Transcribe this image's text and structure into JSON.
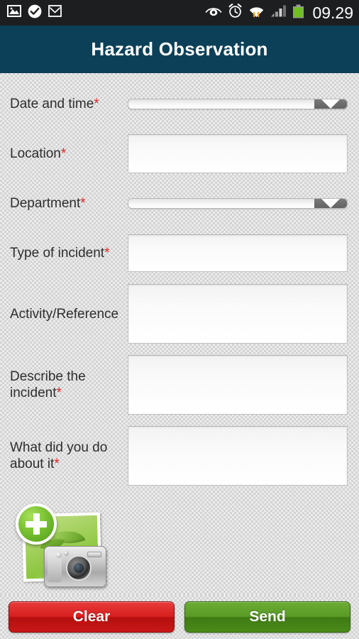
{
  "statusbar": {
    "time": "09.29",
    "left_icons": [
      {
        "name": "image-icon"
      },
      {
        "name": "check-circle-icon"
      },
      {
        "name": "gmail-icon"
      }
    ],
    "right_icons": [
      {
        "name": "eye-icon"
      },
      {
        "name": "alarm-clock-icon"
      },
      {
        "name": "wifi-data-transfer-icon"
      },
      {
        "name": "cellular-signal-icon"
      },
      {
        "name": "battery-icon"
      }
    ]
  },
  "header": {
    "title": "Hazard Observation",
    "background_color": "#0c4058"
  },
  "form": {
    "required_marker": "*",
    "fields": [
      {
        "label": "Date and time",
        "required": true,
        "type": "spinner",
        "value": "",
        "name": "date-and-time"
      },
      {
        "label": "Location",
        "required": true,
        "type": "text",
        "value": "",
        "name": "location"
      },
      {
        "label": "Department",
        "required": true,
        "type": "spinner",
        "value": "",
        "name": "department"
      },
      {
        "label": "Type of incident",
        "required": true,
        "type": "text",
        "value": "",
        "name": "type-of-incident"
      },
      {
        "label": "Activity/Reference",
        "required": false,
        "type": "textarea",
        "value": "",
        "name": "activity-reference"
      },
      {
        "label": "Describe the incident",
        "required": true,
        "type": "textarea",
        "value": "",
        "name": "describe-the-incident"
      },
      {
        "label": "What did you do about it",
        "required": true,
        "type": "textarea",
        "value": "",
        "name": "what-did-you-do-about-it"
      }
    ]
  },
  "attachment": {
    "icon_name": "add-photo-icon",
    "label": ""
  },
  "buttons": {
    "clear_label": "Clear",
    "clear_color": "#d71f1f",
    "send_label": "Send",
    "send_color": "#5a9a26"
  }
}
